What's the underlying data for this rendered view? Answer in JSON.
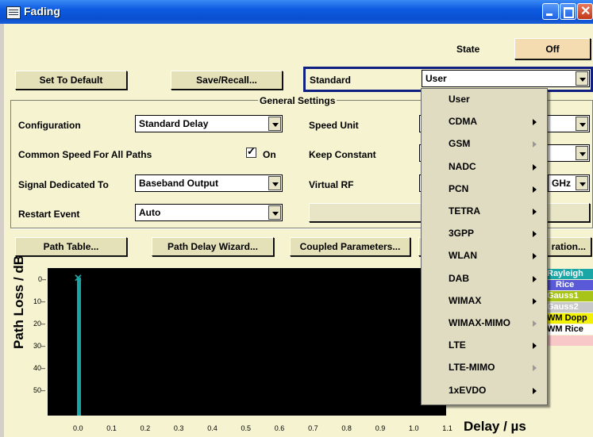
{
  "window": {
    "title": "Fading"
  },
  "header": {
    "state_label": "State",
    "state_value": "Off"
  },
  "toolbar": {
    "set_default": "Set To Default",
    "save_recall": "Save/Recall..."
  },
  "standard": {
    "label": "Standard",
    "value": "User"
  },
  "general": {
    "title": "General Settings",
    "configuration_label": "Configuration",
    "configuration_value": "Standard Delay",
    "common_speed_label": "Common Speed For All Paths",
    "common_speed_on": "On",
    "signal_label": "Signal Dedicated To",
    "signal_value": "Baseband Output",
    "restart_label": "Restart Event",
    "restart_value": "Auto",
    "speed_unit_label": "Speed Unit",
    "keep_constant_label": "Keep Constant",
    "virtual_rf_label": "Virtual RF",
    "virtual_rf_unit": "GHz"
  },
  "buttons": {
    "path_table": "Path Table...",
    "path_delay_wizard": "Path Delay Wizard...",
    "coupled_parameters": "Coupled Parameters...",
    "configuration_partial": "ration..."
  },
  "plot": {
    "ylabel": "Path Loss / dB",
    "xlabel": "Delay  / µs",
    "yticks": [
      "0",
      "10",
      "20",
      "30",
      "40",
      "50"
    ],
    "xticks": [
      "0.0",
      "0.1",
      "0.2",
      "0.3",
      "0.4",
      "0.5",
      "0.6",
      "0.7",
      "0.8",
      "0.9",
      "1.0",
      "1.1"
    ],
    "marker_color": "#1aa3a3"
  },
  "legend": [
    {
      "label": "Rayleigh",
      "bg": "#1aa6a6",
      "fg": "#ffffff"
    },
    {
      "label": "Rice",
      "bg": "#5a5ad8",
      "fg": "#ffffff"
    },
    {
      "label": "Gauss1",
      "bg": "#a8c418",
      "fg": "#ffffff"
    },
    {
      "label": "Gauss2",
      "bg": "#c8c8c8",
      "fg": "#ffffff"
    },
    {
      "label": "WM Dopp",
      "bg": "#f2f200",
      "fg": "#000000"
    },
    {
      "label": "WM Rice",
      "bg": "#ffffff",
      "fg": "#000000"
    },
    {
      "label": "",
      "bg": "#f8c8c8",
      "fg": "#000000"
    }
  ],
  "menu": {
    "items": [
      {
        "label": "User",
        "submenu": "none"
      },
      {
        "label": "CDMA",
        "submenu": "enabled"
      },
      {
        "label": "GSM",
        "submenu": "disabled"
      },
      {
        "label": "NADC",
        "submenu": "enabled"
      },
      {
        "label": "PCN",
        "submenu": "enabled"
      },
      {
        "label": "TETRA",
        "submenu": "enabled"
      },
      {
        "label": "3GPP",
        "submenu": "enabled"
      },
      {
        "label": "WLAN",
        "submenu": "enabled"
      },
      {
        "label": "DAB",
        "submenu": "enabled"
      },
      {
        "label": "WIMAX",
        "submenu": "enabled"
      },
      {
        "label": "WIMAX-MIMO",
        "submenu": "disabled"
      },
      {
        "label": "LTE",
        "submenu": "enabled"
      },
      {
        "label": "LTE-MIMO",
        "submenu": "disabled"
      },
      {
        "label": "1xEVDO",
        "submenu": "enabled"
      }
    ]
  }
}
